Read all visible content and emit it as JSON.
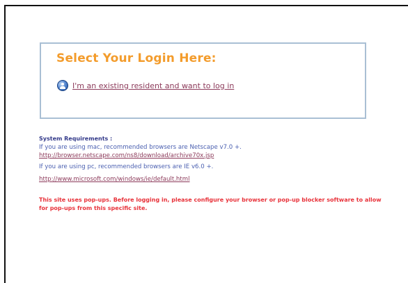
{
  "login": {
    "title": "Select Your Login Here:",
    "existing_resident_link": "I'm an existing resident and want to log in"
  },
  "requirements": {
    "heading": "System Requirements :",
    "mac_text": "If you are using mac, recommended browsers are Netscape v7.0 +.",
    "mac_link": "http://browser.netscape.com/ns8/download/archive70x.jsp",
    "pc_text": "If you are using pc, recommended browsers are IE v6.0 +.",
    "pc_link": "http://www.microsoft.com/windows/ie/default.html",
    "popup_warning": "This site uses pop-ups. Before logging in, please configure your browser or pop-up blocker software to allow for pop-ups from this specific site."
  },
  "colors": {
    "title_orange": "#f39c2c",
    "box_border": "#a9bfd4",
    "link_maroon": "#8c3a5a",
    "text_blue": "#4a5fb0",
    "heading_navy": "#333a8a",
    "warning_red": "#e8323a"
  },
  "icons": {
    "login_icon": "user-icon"
  }
}
